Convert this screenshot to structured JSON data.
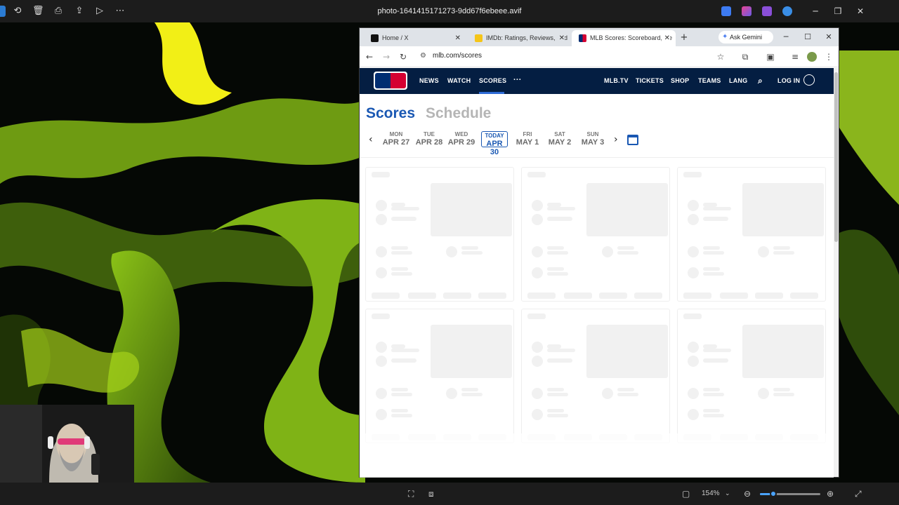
{
  "viewer": {
    "filename": "photo-1641415171273-9dd67f6ebeee.avif",
    "zoom": "154%",
    "zoom_fraction": 0.2,
    "icons": [
      "edit-icon",
      "rotate-icon",
      "delete-icon",
      "print-icon",
      "share-icon",
      "slideshow-icon",
      "more-icon"
    ],
    "bottom_icons": [
      "fit-icon",
      "ocr-icon",
      "fullscreen-toggle-icon",
      "zoom-out-icon",
      "zoom-in-icon",
      "expand-icon"
    ]
  },
  "browser": {
    "tabs": [
      {
        "title": "Home / X",
        "favicon": "x-logo-icon",
        "color": "#111111"
      },
      {
        "title": "IMDb: Ratings, Reviews, and",
        "favicon": "imdb-logo-icon",
        "color": "#f5c518"
      },
      {
        "title": "MLB Scores: Scoreboard, Re",
        "favicon": "mlb-logo-icon",
        "color": "#002d72"
      }
    ],
    "gemini_label": "Ask Gemini",
    "url": "mlb.com/scores"
  },
  "mlb": {
    "nav_left": [
      "NEWS",
      "WATCH",
      "SCORES",
      "···"
    ],
    "nav_right": [
      "MLB.TV",
      "TICKETS",
      "SHOP",
      "TEAMS",
      "LANG"
    ],
    "login": "LOG IN",
    "active_nav": "SCORES",
    "heading_scores": "Scores",
    "heading_schedule": "Schedule",
    "dates": [
      {
        "dow": "MON",
        "dm": "APR 27"
      },
      {
        "dow": "TUE",
        "dm": "APR 28"
      },
      {
        "dow": "WED",
        "dm": "APR 29"
      },
      {
        "dow": "TODAY",
        "dm": "APR 30"
      },
      {
        "dow": "FRI",
        "dm": "MAY 1"
      },
      {
        "dow": "SAT",
        "dm": "MAY 2"
      },
      {
        "dow": "SUN",
        "dm": "MAY 3"
      }
    ],
    "accent": "#1a58b3",
    "nav_bg": "#041e42"
  }
}
